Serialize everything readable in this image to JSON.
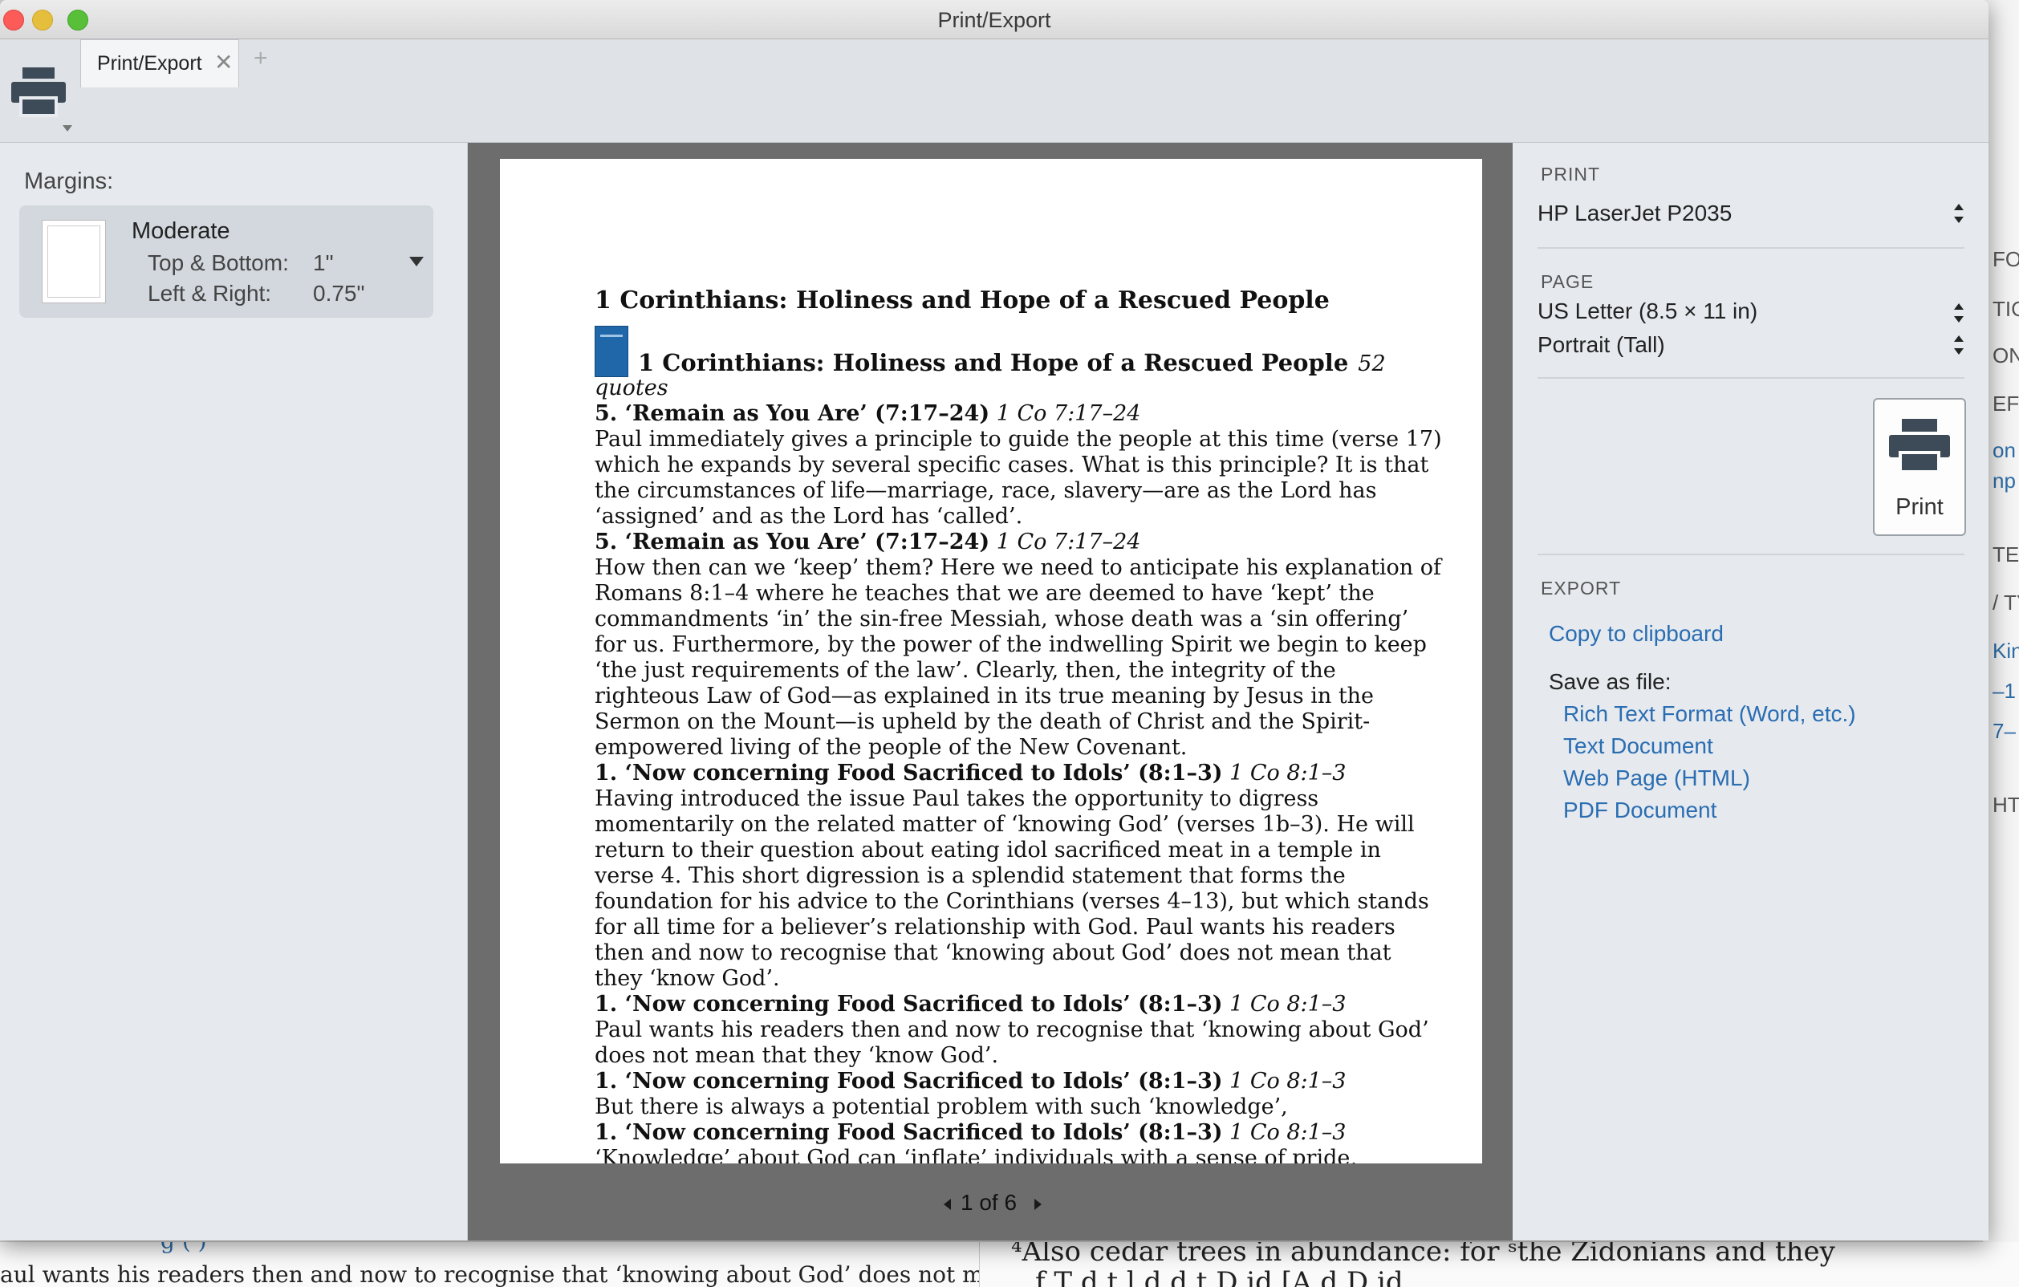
{
  "window": {
    "title": "Print/Export"
  },
  "tabs": [
    {
      "label": "Print/Export"
    }
  ],
  "icons": {
    "printer": "printer-icon",
    "tab_close": "close-icon",
    "tab_add": "plus-icon"
  },
  "glyphs": {
    "tab_close": "✕",
    "tab_add": "+"
  },
  "margins": {
    "label": "Margins:",
    "preset": "Moderate",
    "top_bottom_label": "Top & Bottom:",
    "top_bottom_value": "1\"",
    "left_right_label": "Left & Right:",
    "left_right_value": "0.75\""
  },
  "document": {
    "title": "1 Corinthians: Holiness and Hope of a Rescued People",
    "book_title": "1 Corinthians: Holiness and Hope of a Rescued People",
    "quote_count": "52",
    "quotes_label": "quotes",
    "entries": [
      {
        "heading": "5. ‘Remain as You Are’ (7:17–24)",
        "ref": "1 Co 7:17–24",
        "text": "Paul immediately gives a principle to guide the people at this time (verse 17) which he expands by several specific cases. What is this principle? It is that the circumstances of life—marriage, race, slavery—are as the Lord has ‘assigned’ and as the Lord has ‘called’."
      },
      {
        "heading": "5. ‘Remain as You Are’ (7:17–24)",
        "ref": "1 Co 7:17–24",
        "text": "How then can we ‘keep’ them? Here we need to anticipate his explanation of Romans 8:1–4 where he teaches that we are deemed to have ‘kept’ the commandments ‘in’ the sin-free Messiah, whose death was a ‘sin offering’ for us. Furthermore, by the power of the indwelling Spirit we begin to keep ‘the just requirements of the law’. Clearly, then, the integrity of the righteous Law of God—as explained in its true meaning by Jesus in the Sermon on the Mount—is upheld by the death of Christ and the Spirit-empowered living of the people of the New Covenant."
      },
      {
        "heading": "1. ‘Now concerning Food Sacrificed to Idols’ (8:1–3)",
        "ref": "1 Co 8:1–3",
        "text": "Having introduced the issue Paul takes the opportunity to digress momentarily on the related matter of ‘knowing God’ (verses 1b–3). He will return to their question about eating idol sacrificed meat in a temple in verse 4. This short digression is a splendid statement that forms the foundation for his advice to the Corinthians (verses 4–13), but which stands for all time for a believer’s relationship with God. Paul wants his readers then and now to recognise that ‘knowing about God’ does not mean that they ‘know God’."
      },
      {
        "heading": "1. ‘Now concerning Food Sacrificed to Idols’ (8:1–3)",
        "ref": "1 Co 8:1–3",
        "text": "Paul wants his readers then and now to recognise that ‘knowing about God’ does not mean that they ‘know God’."
      },
      {
        "heading": "1. ‘Now concerning Food Sacrificed to Idols’ (8:1–3)",
        "ref": "1 Co 8:1–3",
        "text": "But there is always a potential problem with such ‘knowledge’,"
      },
      {
        "heading": "1. ‘Now concerning Food Sacrificed to Idols’ (8:1–3)",
        "ref": "1 Co 8:1–3",
        "text": "‘Knowledge’ about God can ‘inflate’ individuals with a sense of pride,"
      }
    ]
  },
  "pager": {
    "text": "1 of 6"
  },
  "print_section": {
    "label": "PRINT",
    "printer": "HP LaserJet P2035",
    "button_label": "Print"
  },
  "page_section": {
    "label": "PAGE",
    "paper_size": "US Letter (8.5 × 11 in)",
    "orientation": "Portrait (Tall)"
  },
  "export_section": {
    "label": "EXPORT",
    "copy_clipboard": "Copy to clipboard",
    "save_as_label": "Save as file:",
    "formats": [
      "Rich Text Format (Word, etc.)",
      "Text Document",
      "Web Page (HTML)",
      "PDF Document"
    ]
  },
  "background": {
    "right_fragments": [
      "FO",
      "TIC",
      "ON",
      "EFI",
      "on",
      "np",
      "TES",
      "/ TY",
      "Kin",
      "–1",
      "7–",
      "HTS"
    ],
    "bottom_left_text": "aul wants his readers then and now to recognise that ‘knowing about God’ does not mean",
    "bottom_left_partial": "g                                    (    )",
    "bottom_right_text_1": "⁴Also cedar trees in abundance: for ˢthe Zidonians and they",
    "bottom_right_text_2": "f T            d     t        l      d     d t  D  id  [A d D id"
  },
  "colors": {
    "link": "#2a6db2",
    "preview_bg": "#6d6d6d",
    "book_icon": "#1f67a8"
  }
}
